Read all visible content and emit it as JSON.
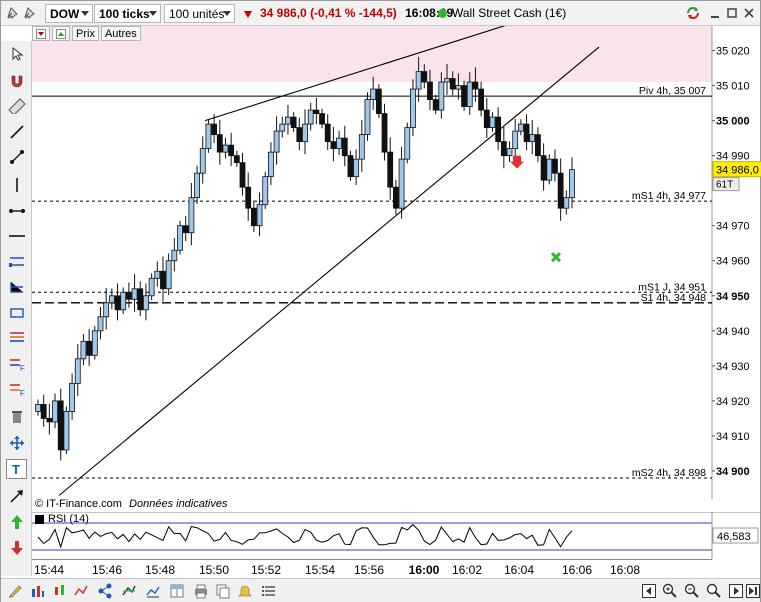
{
  "toolbar": {
    "symbol": "DOW",
    "ticks": "100 ticks",
    "units": "100 unités",
    "last": "34 986,0",
    "change": "(-0,41 % -144,5)",
    "time": "16:08:09",
    "instrument": "Wall Street Cash (1€)"
  },
  "subbar": {
    "prix": "Prix",
    "autres": "Autres"
  },
  "source": {
    "brand": "© IT-Finance.com",
    "note": "Données indicatives"
  },
  "rsi": {
    "label": "RSI (14)",
    "value": "46,583"
  },
  "price_axis": {
    "labels": [
      {
        "text": "35 020",
        "bold": false,
        "price": 35020
      },
      {
        "text": "35 010",
        "bold": false,
        "price": 35010
      },
      {
        "text": "35 000",
        "bold": true,
        "price": 35000
      },
      {
        "text": "34 990",
        "bold": false,
        "price": 34990
      },
      {
        "text": "34 970",
        "bold": false,
        "price": 34970
      },
      {
        "text": "34 960",
        "bold": false,
        "price": 34960
      },
      {
        "text": "34 950",
        "bold": true,
        "price": 34950
      },
      {
        "text": "34 940",
        "bold": false,
        "price": 34940
      },
      {
        "text": "34 930",
        "bold": false,
        "price": 34930
      },
      {
        "text": "34 920",
        "bold": false,
        "price": 34920
      },
      {
        "text": "34 910",
        "bold": false,
        "price": 34910
      },
      {
        "text": "34 900",
        "bold": true,
        "price": 34900
      }
    ],
    "current": "34 986,0",
    "current_price": 34986,
    "badge": "61T"
  },
  "levels": [
    {
      "label": "Piv 4h, 35 007",
      "price": 35007,
      "style": "solid"
    },
    {
      "label": "mS1 4h, 34 977",
      "price": 34977,
      "style": "dashed"
    },
    {
      "label": "mS1 J, 34 951",
      "price": 34951,
      "style": "dashed"
    },
    {
      "label": "S1 4h, 34 948",
      "price": 34948,
      "style": "longdash"
    },
    {
      "label": "mS2 4h, 34 898",
      "price": 34898,
      "style": "dashed"
    }
  ],
  "resistance_zone": {
    "from": 35011,
    "to": 35030
  },
  "time_axis": [
    {
      "t": "15:44",
      "bold": false
    },
    {
      "t": "15:46",
      "bold": false
    },
    {
      "t": "15:48",
      "bold": false
    },
    {
      "t": "15:50",
      "bold": false
    },
    {
      "t": "15:52",
      "bold": false
    },
    {
      "t": "15:54",
      "bold": false
    },
    {
      "t": "15:56",
      "bold": false
    },
    {
      "t": "16:00",
      "bold": true
    },
    {
      "t": "16:02",
      "bold": false
    },
    {
      "t": "16:04",
      "bold": false
    },
    {
      "t": "16:06",
      "bold": false
    },
    {
      "t": "16:08",
      "bold": false
    }
  ],
  "chart_data": {
    "type": "candlestick",
    "ylim": [
      34892,
      35027
    ],
    "closes": [
      34919,
      34915,
      34914,
      34920,
      34906,
      34917,
      34925,
      34932,
      34937,
      34933,
      34940,
      34944,
      34948,
      34950,
      34946,
      34951,
      34949,
      34952,
      34946,
      34950,
      34955,
      34957,
      34952,
      34960,
      34963,
      34970,
      34968,
      34978,
      34985,
      34992,
      34999,
      34996,
      34991,
      34993,
      34990,
      34988,
      34981,
      34975,
      34970,
      34976,
      34984,
      34991,
      34997,
      34999,
      35001,
      34998,
      34994,
      34999,
      35003,
      35002,
      34999,
      34994,
      34992,
      34995,
      34990,
      34984,
      34989,
      34996,
      35006,
      35009,
      35002,
      34991,
      34981,
      34975,
      34989,
      34998,
      35009,
      35014,
      35011,
      35006,
      35003,
      35011,
      35012,
      35009,
      35010,
      35004,
      35011,
      35009,
      35003,
      34998,
      35001,
      34994,
      34990,
      34992,
      34997,
      34999,
      34994,
      34996,
      34990,
      34983,
      34989,
      34985,
      34975,
      34978,
      34986
    ],
    "series_note": "approximate OHLC read from tick candles"
  }
}
